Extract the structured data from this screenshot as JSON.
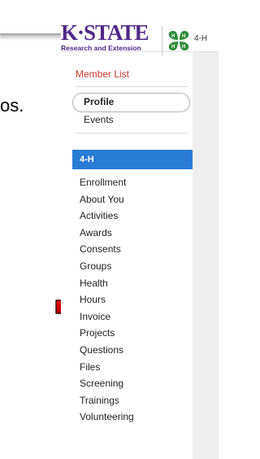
{
  "slide": {
    "trailing_text": "os."
  },
  "header": {
    "logo_text": "K·STATE",
    "logo_subtitle": "Research and Extension",
    "title": "4-H"
  },
  "nav": {
    "member_list": "Member List",
    "profile": "Profile",
    "events": "Events",
    "section_title": "4-H",
    "items": [
      "Enrollment",
      "About You",
      "Activities",
      "Awards",
      "Consents",
      "Groups",
      "Health",
      "Hours",
      "Invoice",
      "Projects",
      "Questions",
      "Files",
      "Screening",
      "Trainings",
      "Volunteering"
    ]
  },
  "colors": {
    "brand_purple": "#512888",
    "clover_green": "#2e8b3a",
    "section_blue": "#2a7bd6",
    "link_red": "#c0392b",
    "arrow_red": "#d40000"
  }
}
